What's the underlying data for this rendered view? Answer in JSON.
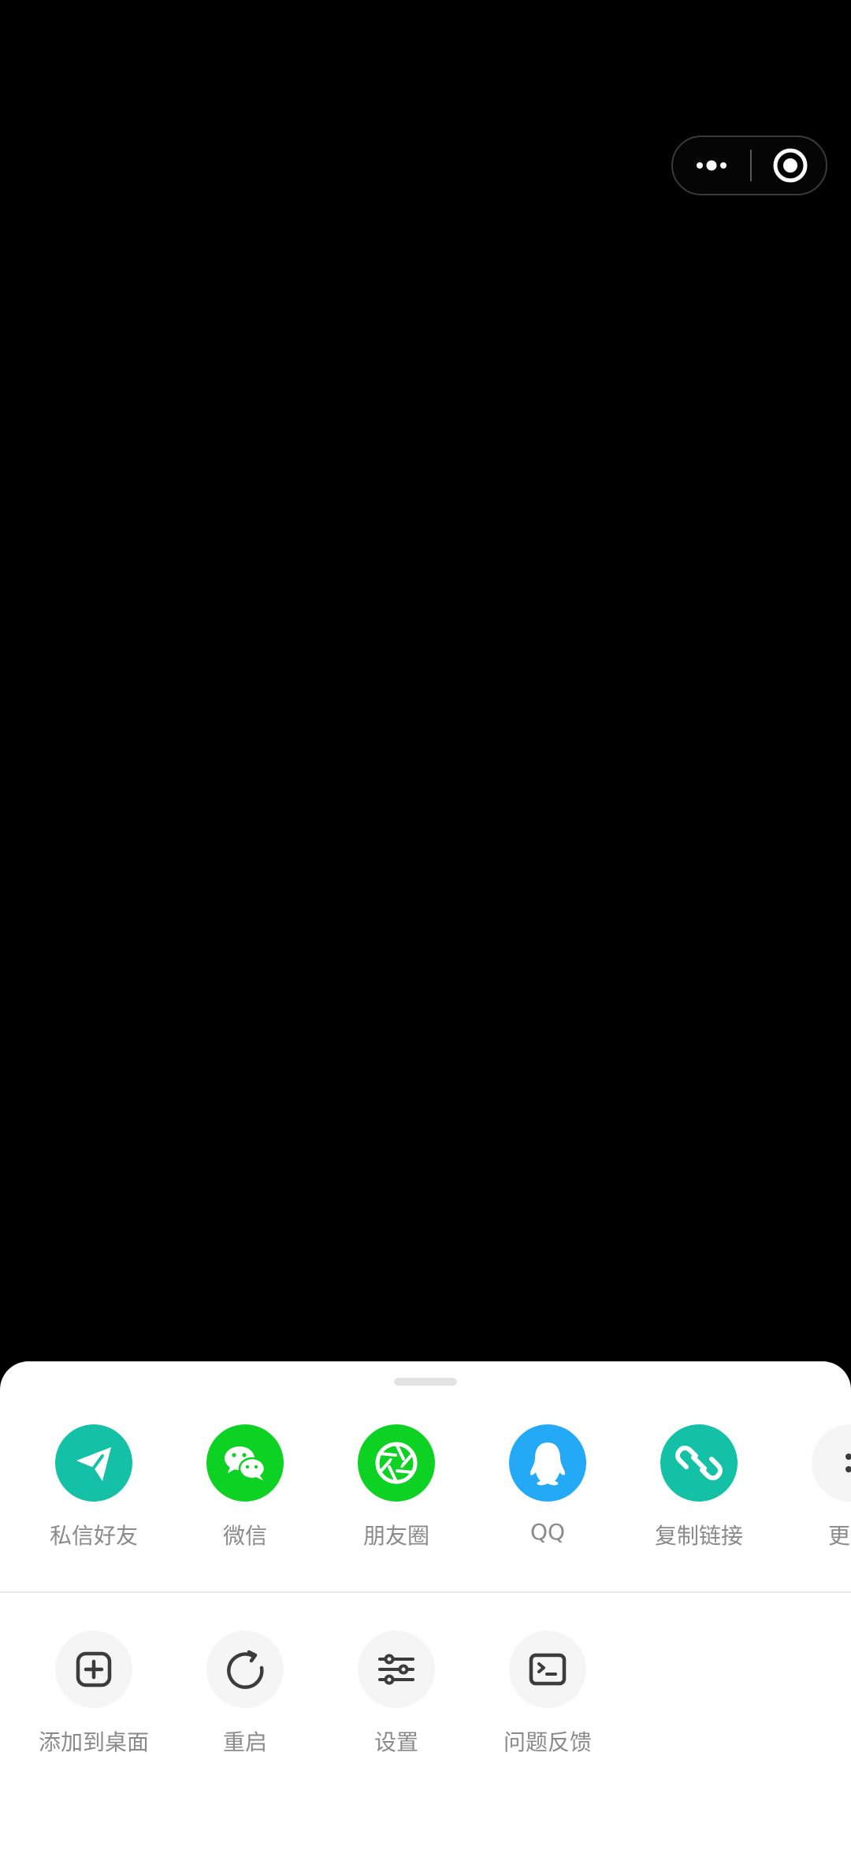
{
  "share_row": [
    {
      "name": "private-message",
      "label": "私信好友",
      "icon": "paper-plane-icon",
      "color": "#14c1a6"
    },
    {
      "name": "wechat",
      "label": "微信",
      "icon": "wechat-icon",
      "color": "#0ed223"
    },
    {
      "name": "moments",
      "label": "朋友圈",
      "icon": "moments-aperture-icon",
      "color": "#0ed223"
    },
    {
      "name": "qq",
      "label": "QQ",
      "icon": "qq-penguin-icon",
      "color": "#23a9f5"
    },
    {
      "name": "copy-link",
      "label": "复制链接",
      "icon": "link-icon",
      "color": "#14c1a6"
    },
    {
      "name": "more",
      "label": "更多",
      "icon": "more-icon",
      "color": "#f5f5f5"
    }
  ],
  "function_row": [
    {
      "name": "add-to-desktop",
      "label": "添加到桌面",
      "icon": "plus-square-icon"
    },
    {
      "name": "restart",
      "label": "重启",
      "icon": "restart-icon"
    },
    {
      "name": "settings",
      "label": "设置",
      "icon": "sliders-icon"
    },
    {
      "name": "feedback",
      "label": "问题反馈",
      "icon": "terminal-icon"
    }
  ],
  "colors": {
    "background": "#000000",
    "sheet": "#ffffff",
    "label": "#8a8a8a",
    "icon_dark": "#3c3c3c",
    "func_circle": "#f5f5f5"
  }
}
